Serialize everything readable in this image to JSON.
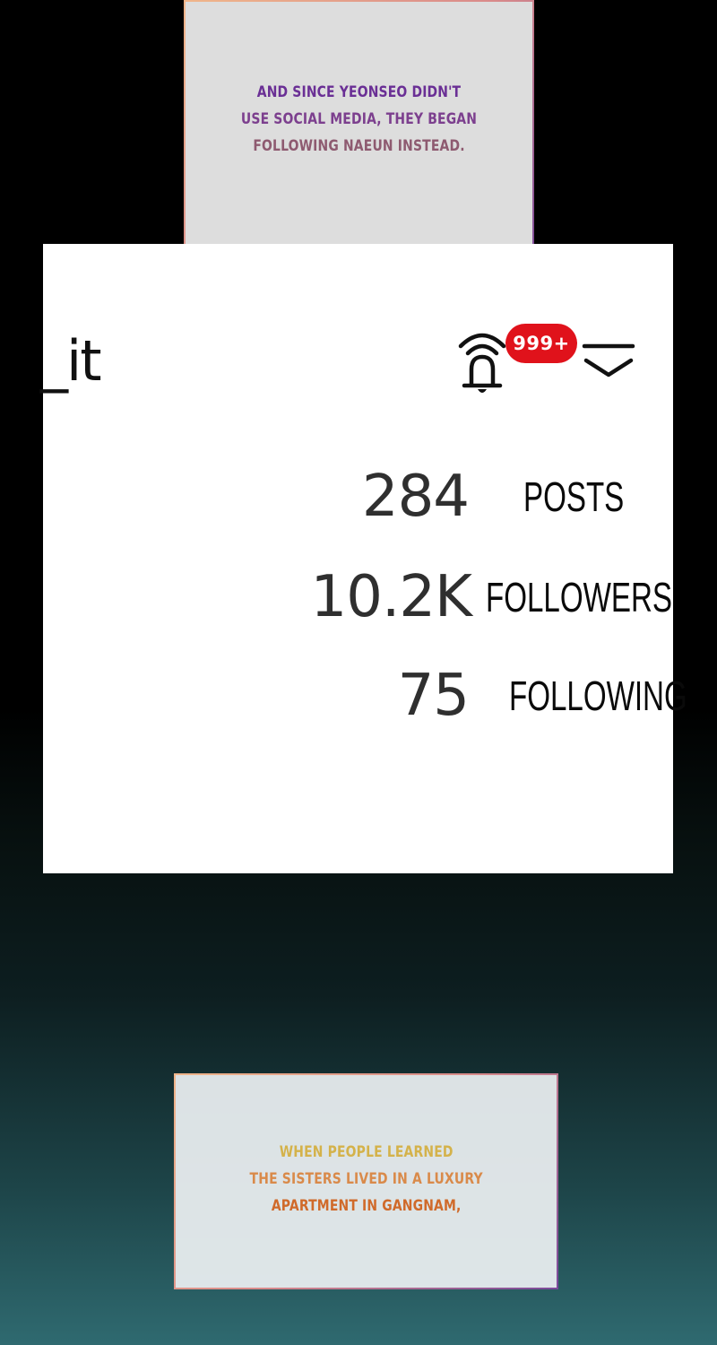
{
  "captions": {
    "top": {
      "lines": [
        "AND SINCE YEONSEO DIDN'T",
        "USE SOCIAL MEDIA, THEY BEGAN",
        "FOLLOWING NAEUN INSTEAD."
      ]
    },
    "bottom": {
      "lines": [
        "WHEN PEOPLE LEARNED",
        "THE SISTERS LIVED IN A LUXURY",
        "APARTMENT IN GANGNAM,"
      ]
    }
  },
  "profile": {
    "username_fragment": "_it",
    "notification_badge": "999+",
    "icons": {
      "notifications": "bell-icon",
      "menu": "chevron-down-icon"
    },
    "stats": {
      "posts": {
        "value": "284",
        "label": "POSTS"
      },
      "followers": {
        "value": "10.2K",
        "label": "FOLLOWERS"
      },
      "following": {
        "value": "75",
        "label": "FOLLOWING"
      }
    }
  },
  "colors": {
    "badge": "#e0121b",
    "caption_top_text": "#6a2f95",
    "caption_bottom_text": "#d98a4a"
  }
}
